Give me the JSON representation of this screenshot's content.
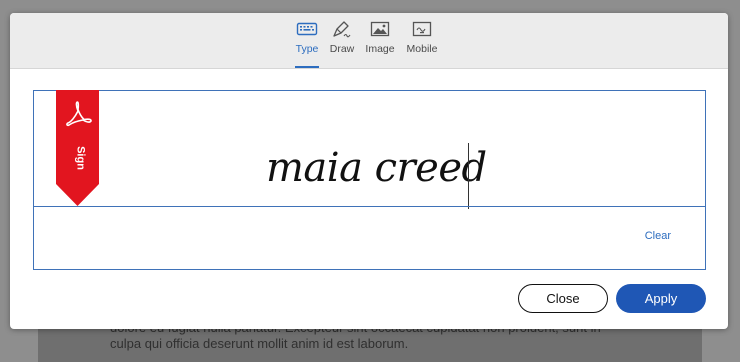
{
  "background": {
    "line1": "dolore eu fugiat nulla pariatur. Excepteur sint occaecat cupidatat non proident, sunt in",
    "line2": "culpa qui officia deserunt mollit anim id est laborum."
  },
  "tabs": [
    {
      "label": "Type",
      "icon": "keyboard-icon",
      "active": true
    },
    {
      "label": "Draw",
      "icon": "pen-icon",
      "active": false
    },
    {
      "label": "Image",
      "icon": "image-icon",
      "active": false
    },
    {
      "label": "Mobile",
      "icon": "mobile-icon",
      "active": false
    }
  ],
  "signature": {
    "ribbon_label": "Sign",
    "typed_name": "maia creed",
    "clear_label": "Clear"
  },
  "buttons": {
    "close_label": "Close",
    "apply_label": "Apply"
  },
  "colors": {
    "accent": "#2d6dbf",
    "apply_button": "#1f57b5",
    "ribbon": "#e2151f"
  }
}
